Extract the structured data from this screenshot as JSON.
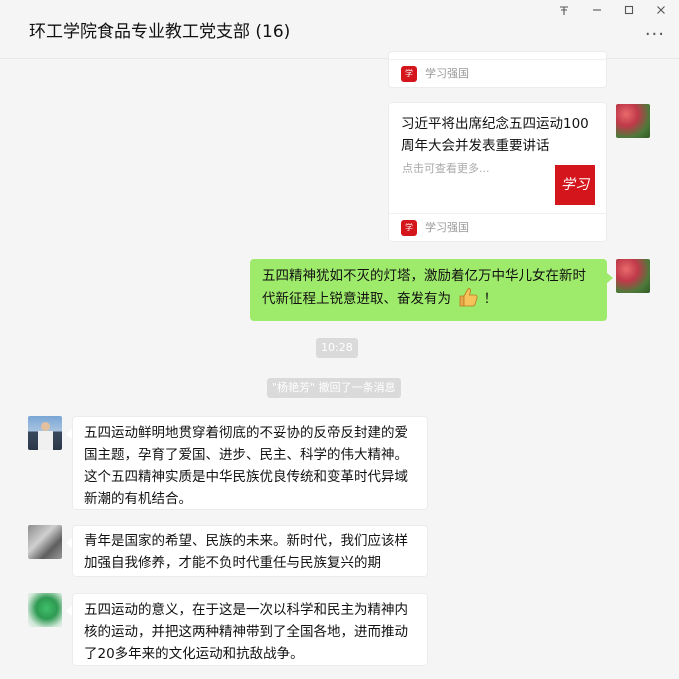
{
  "window": {
    "title": "环工学院食品专业教工党支部 (16)",
    "pin_icon": "pin-icon",
    "min_icon": "minimize-icon",
    "max_icon": "maximize-icon",
    "close_icon": "close-icon",
    "more_label": "···"
  },
  "colors": {
    "background": "#f5f5f5",
    "bubble_green": "#9eea6a",
    "bubble_white": "#ffffff",
    "brand_red": "#d4151b"
  },
  "messages": {
    "card_top": {
      "source": "学习强国",
      "source_icon": "xuexi-qiangguo-icon"
    },
    "card_article": {
      "title": "习近平将出席纪念五四运动100周年大会并发表重要讲话",
      "description": "点击可查看更多...",
      "thumbnail_text": "学习",
      "source": "学习强国"
    },
    "self_message": {
      "text": "五四精神犹如不灭的灯塔，激励着亿万中华儿女在新时代新征程上锐意进取、奋发有为",
      "emoji": "thumbs-up-emoji",
      "tail": "！"
    },
    "timestamp": "10:28",
    "recall_notice": "\"杨艳芳\" 撤回了一条消息",
    "msg1": {
      "text": "五四运动鲜明地贯穿着彻底的不妥协的反帝反封建的爱国主题，孕育了爱国、进步、民主、科学的伟大精神。这个五四精神实质是中华民族优良传统和变革时代异域新潮的有机结合。"
    },
    "msg2": {
      "text": "青年是国家的希望、民族的未来。新时代，我们应该样加强自我修养，才能不负时代重任与民族复兴的期"
    },
    "msg3": {
      "text": "五四运动的意义，在于这是一次以科学和民主为精神内核的运动，并把这两种精神带到了全国各地，进而推动了20多年来的文化运动和抗敌战争。"
    }
  }
}
